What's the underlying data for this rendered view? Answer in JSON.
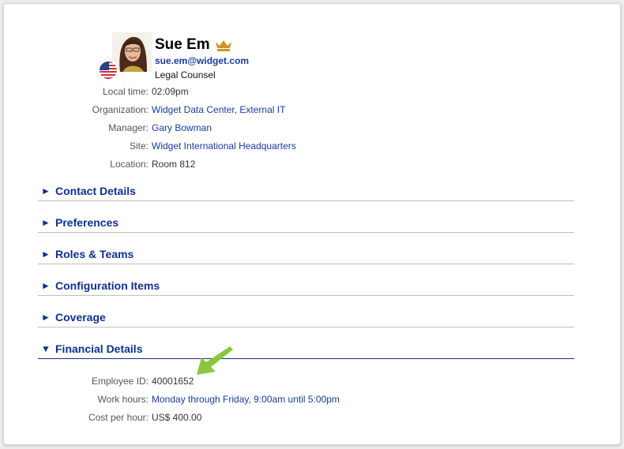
{
  "profile": {
    "name": "Sue Em",
    "email": "sue.em@widget.com",
    "job_title": "Legal Counsel",
    "vip_icon": "crown-icon",
    "flag_icon": "us-flag-icon",
    "avatar": "profile-photo"
  },
  "details": [
    {
      "label": "Local time:",
      "value": "02:09pm",
      "link": false
    },
    {
      "label": "Organization:",
      "value": "Widget Data Center, External IT",
      "link": true
    },
    {
      "label": "Manager:",
      "value": "Gary Bowman",
      "link": true
    },
    {
      "label": "Site:",
      "value": "Widget International Headquarters",
      "link": true
    },
    {
      "label": "Location:",
      "value": "Room 812",
      "link": false
    }
  ],
  "sections": [
    {
      "label": "Contact Details",
      "expanded": false,
      "icon": "triangle-right-icon",
      "glyph": "►"
    },
    {
      "label": "Preferences",
      "expanded": false,
      "icon": "triangle-right-icon",
      "glyph": "►"
    },
    {
      "label": "Roles & Teams",
      "expanded": false,
      "icon": "triangle-right-icon",
      "glyph": "►"
    },
    {
      "label": "Configuration Items",
      "expanded": false,
      "icon": "triangle-right-icon",
      "glyph": "►"
    },
    {
      "label": "Coverage",
      "expanded": false,
      "icon": "triangle-right-icon",
      "glyph": "►"
    },
    {
      "label": "Financial Details",
      "expanded": true,
      "icon": "triangle-down-icon",
      "glyph": "▼"
    }
  ],
  "financial": [
    {
      "label": "Employee ID:",
      "value": "40001652",
      "link": false
    },
    {
      "label": "Work hours:",
      "value": "Monday through Friday, 9:00am until 5:00pm",
      "link": true
    },
    {
      "label": "Cost per hour:",
      "value": "US$ 400.00",
      "link": false
    }
  ],
  "annotation": {
    "icon": "green-arrow-icon",
    "color": "#8cc63f"
  },
  "colors": {
    "accent": "#102f8f",
    "link": "#1a3aa0",
    "label": "#555555",
    "divider": "#c0c0c0",
    "open_divider": "#1b2f7a",
    "crown": "#c8952b"
  }
}
